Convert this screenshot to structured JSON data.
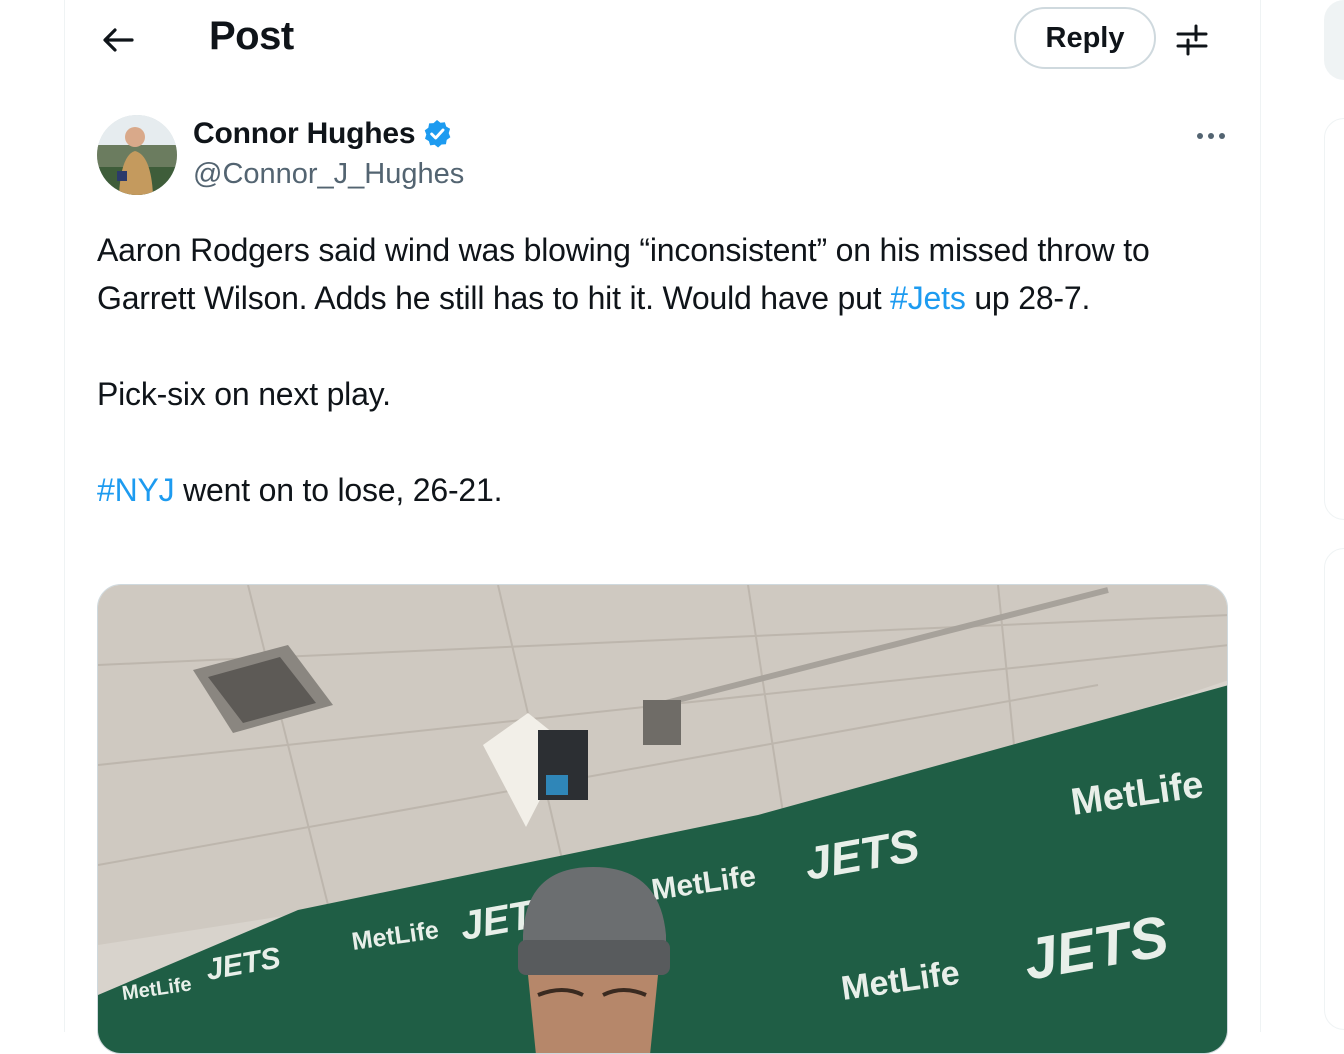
{
  "header": {
    "title": "Post",
    "reply_label": "Reply"
  },
  "icons": {
    "back": "arrow-left-icon",
    "filter": "sliders-icon",
    "more": "more-horizontal-icon",
    "verified": "verified-badge-icon"
  },
  "author": {
    "name": "Connor Hughes",
    "handle": "@Connor_J_Hughes",
    "verified": true
  },
  "tweet": {
    "line1_a": "Aaron Rodgers said wind was blowing “inconsistent” on his missed throw to Garrett Wilson. Adds he still has to hit it. Would have put ",
    "line1_tag": "#Jets",
    "line1_b": " up 28-7.",
    "line2": "Pick-six on next play.",
    "line3_tag": "#NYJ",
    "line3_b": " went on to lose, 26-21."
  },
  "media": {
    "backdrop_text": {
      "metlife": "MetLife",
      "jets": "JETS"
    }
  },
  "colors": {
    "accent": "#1d9bf0",
    "text": "#0f1419",
    "muted": "#536471",
    "backdrop_green": "#1f5e45"
  }
}
